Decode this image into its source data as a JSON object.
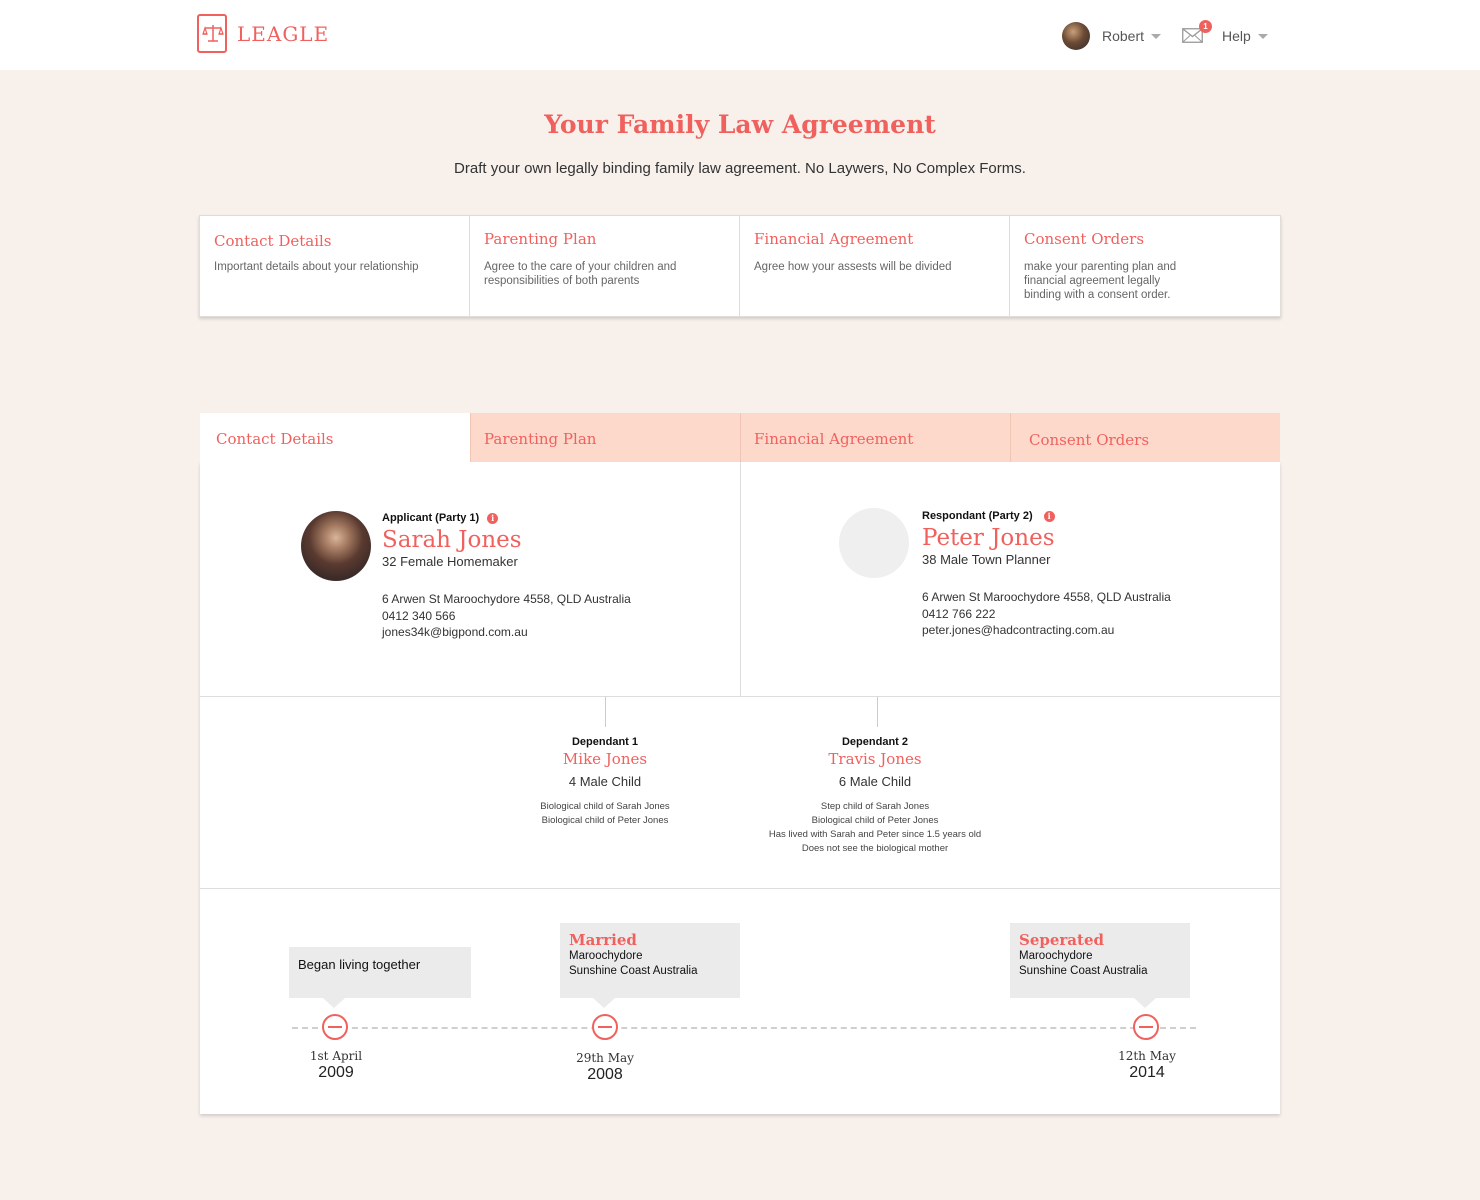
{
  "brand": {
    "name": "LEAGLE",
    "accent": "#f0615e"
  },
  "header": {
    "user_name": "Robert",
    "mail_count": "1",
    "help_label": "Help"
  },
  "hero": {
    "title": "Your Family Law Agreement",
    "subtitle": "Draft your own legally binding family law agreement. No Laywers, No Complex Forms."
  },
  "steps": [
    {
      "title": "Contact Details",
      "desc": "Important details about your relationship"
    },
    {
      "title": "Parenting Plan",
      "desc": "Agree to the care of your children and responsibilities of both parents"
    },
    {
      "title": "Financial Agreement",
      "desc": "Agree how your assests will be divided"
    },
    {
      "title": "Consent Orders",
      "desc": "make your parenting plan and financial agreement legally binding with a consent order."
    }
  ],
  "tabs": [
    "Contact Details",
    "Parenting Plan",
    "Financial Agreement",
    "Consent Orders"
  ],
  "applicant": {
    "role": "Applicant (Party 1)",
    "name": "Sarah Jones",
    "meta": "32 Female Homemaker",
    "address": "6 Arwen St Maroochydore 4558, QLD Australia",
    "phone": "0412 340 566",
    "email": "jones34k@bigpond.com.au"
  },
  "respondent": {
    "role": "Respondant (Party 2)",
    "name": "Peter Jones",
    "meta": "38 Male Town Planner",
    "address": "6 Arwen St Maroochydore 4558, QLD Australia",
    "phone": "0412 766 222",
    "email": "peter.jones@hadcontracting.com.au"
  },
  "dependants": [
    {
      "role": "Dependant 1",
      "name": "Mike Jones",
      "meta": "4 Male Child",
      "notes": [
        "Biological child of Sarah Jones",
        "Biological child of Peter Jones"
      ]
    },
    {
      "role": "Dependant 2",
      "name": "Travis Jones",
      "meta": "6 Male Child",
      "notes": [
        "Step child of Sarah Jones",
        "Biological child of Peter Jones",
        "Has lived with Sarah and Peter since 1.5 years old",
        "Does not see the biological mother"
      ]
    }
  ],
  "timeline": [
    {
      "label": "Began living together",
      "day": "1st April",
      "year": "2009"
    },
    {
      "title": "Married",
      "line1": "Maroochydore",
      "line2": "Sunshine Coast Australia",
      "day": "29th May",
      "year": "2008"
    },
    {
      "title": "Seperated",
      "line1": "Maroochydore",
      "line2": "Sunshine Coast Australia",
      "day": "12th May",
      "year": "2014"
    }
  ]
}
